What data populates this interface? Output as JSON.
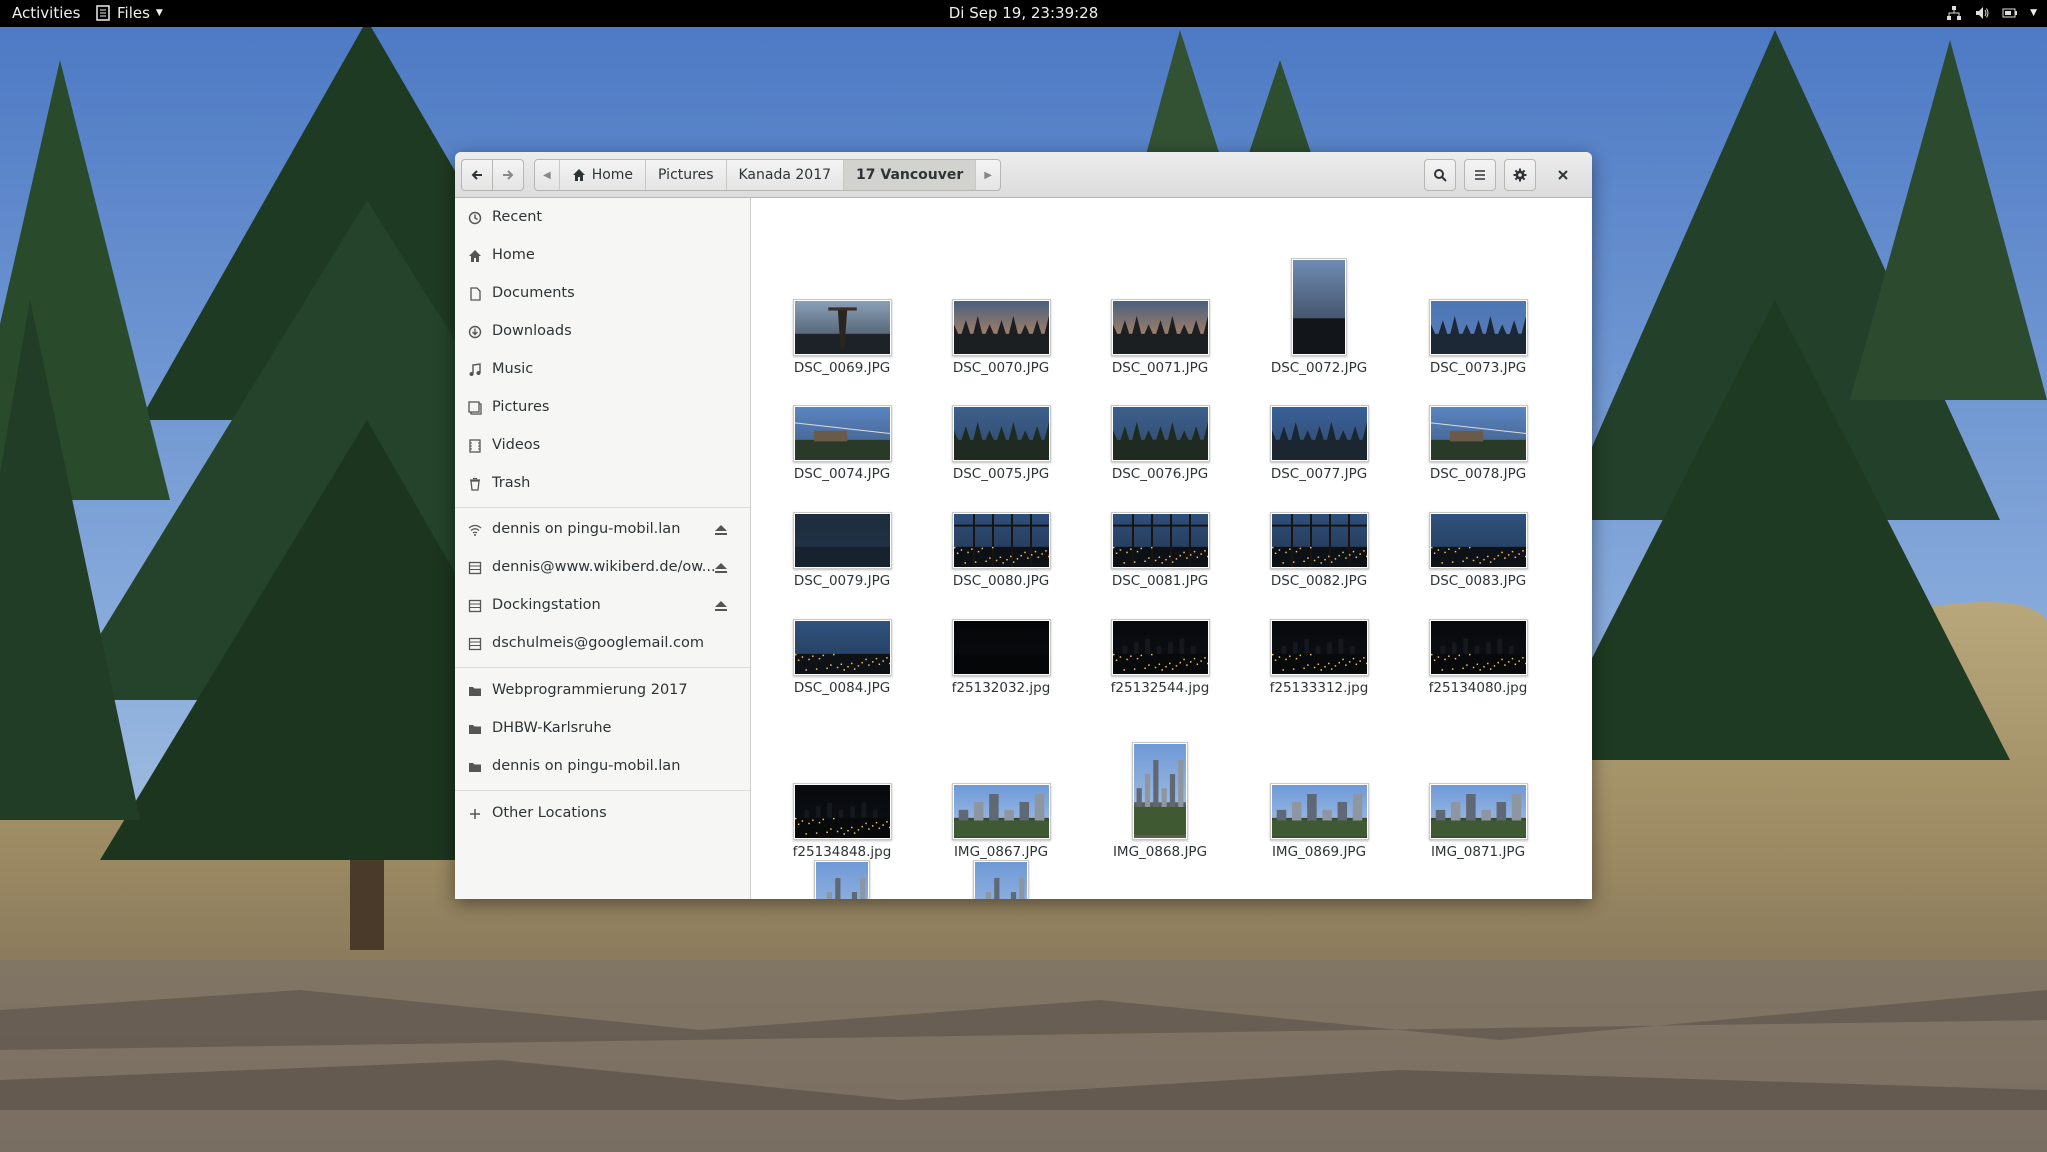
{
  "topbar": {
    "activities": "Activities",
    "app_menu": "Files",
    "clock": "Di Sep 19, 23:39:28"
  },
  "window": {
    "nav": {
      "back_icon": "go-previous-icon",
      "forward_icon": "go-next-icon"
    },
    "path": [
      "Home",
      "Pictures",
      "Kanada 2017",
      "17 Vancouver"
    ],
    "header_icons": [
      "search-icon",
      "list-view-icon",
      "gear-icon",
      "close-icon"
    ]
  },
  "sidebar": {
    "places": [
      {
        "label": "Recent",
        "icon": "clock-icon"
      },
      {
        "label": "Home",
        "icon": "home-icon"
      },
      {
        "label": "Documents",
        "icon": "document-icon"
      },
      {
        "label": "Downloads",
        "icon": "download-icon"
      },
      {
        "label": "Music",
        "icon": "music-icon"
      },
      {
        "label": "Pictures",
        "icon": "picture-icon"
      },
      {
        "label": "Videos",
        "icon": "video-icon"
      },
      {
        "label": "Trash",
        "icon": "trash-icon"
      }
    ],
    "devices": [
      {
        "label": "dennis on pingu-mobil.lan",
        "icon": "network-icon",
        "eject": true
      },
      {
        "label": "dennis@www.wikiberd.de/ow...",
        "icon": "drive-icon",
        "eject": true
      },
      {
        "label": "Dockingstation",
        "icon": "drive-icon",
        "eject": true
      },
      {
        "label": "dschulmeis@googlemail.com",
        "icon": "drive-icon",
        "eject": false
      }
    ],
    "bookmarks": [
      {
        "label": "Webprogrammierung 2017",
        "icon": "folder-icon"
      },
      {
        "label": "DHBW-Karlsruhe",
        "icon": "folder-icon"
      },
      {
        "label": "dennis on pingu-mobil.lan",
        "icon": "folder-icon"
      }
    ],
    "other": {
      "label": "Other Locations",
      "icon": "plus-icon"
    }
  },
  "files": [
    {
      "name": "DSC_0069.JPG",
      "scene": "tower"
    },
    {
      "name": "DSC_0070.JPG",
      "scene": "sunset"
    },
    {
      "name": "DSC_0071.JPG",
      "scene": "sunset"
    },
    {
      "name": "DSC_0072.JPG",
      "scene": "portrait-dusk"
    },
    {
      "name": "DSC_0073.JPG",
      "scene": "blue-hill"
    },
    {
      "name": "DSC_0074.JPG",
      "scene": "chairlift"
    },
    {
      "name": "DSC_0075.JPG",
      "scene": "forest-dusk"
    },
    {
      "name": "DSC_0076.JPG",
      "scene": "forest-dusk"
    },
    {
      "name": "DSC_0077.JPG",
      "scene": "lodge"
    },
    {
      "name": "DSC_0078.JPG",
      "scene": "chairlift"
    },
    {
      "name": "DSC_0079.JPG",
      "scene": "dark-blue"
    },
    {
      "name": "DSC_0080.JPG",
      "scene": "city-lights-fence"
    },
    {
      "name": "DSC_0081.JPG",
      "scene": "city-lights-fence"
    },
    {
      "name": "DSC_0082.JPG",
      "scene": "city-lights-fence"
    },
    {
      "name": "DSC_0083.JPG",
      "scene": "city-lights"
    },
    {
      "name": "DSC_0084.JPG",
      "scene": "city-lights"
    },
    {
      "name": "f25132032.jpg",
      "scene": "night"
    },
    {
      "name": "f25132544.jpg",
      "scene": "night-skyline"
    },
    {
      "name": "f25133312.jpg",
      "scene": "night-skyline"
    },
    {
      "name": "f25134080.jpg",
      "scene": "night-skyline"
    },
    {
      "name": "f25134848.jpg",
      "scene": "night-skyline"
    },
    {
      "name": "IMG_0867.JPG",
      "scene": "city-day"
    },
    {
      "name": "IMG_0868.JPG",
      "scene": "portrait-city"
    },
    {
      "name": "IMG_0869.JPG",
      "scene": "city-day"
    },
    {
      "name": "IMG_0871.JPG",
      "scene": "city-day"
    },
    {
      "name": "",
      "scene": "portrait-city"
    },
    {
      "name": "",
      "scene": "portrait-city"
    }
  ],
  "colors": {
    "topbar_bg": "#000000",
    "window_bg": "#ffffff",
    "sidebar_bg": "#f6f6f5",
    "headerbar_bg": "#e4e4e4"
  }
}
